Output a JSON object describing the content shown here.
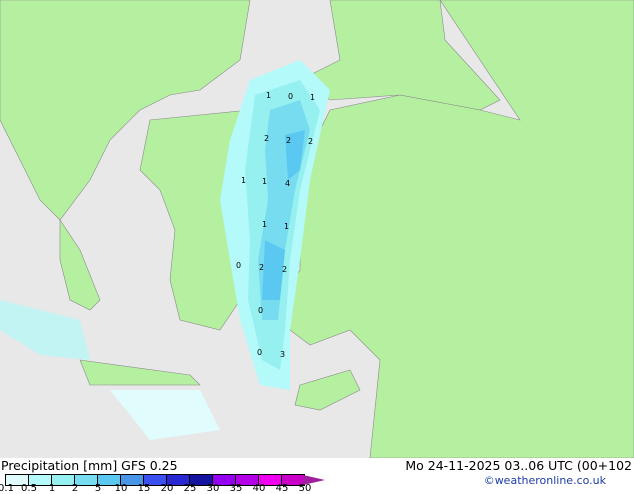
{
  "map": {
    "land_color": "#b4f0a0",
    "sea_color": "#e8e8e8",
    "precip_labels": [
      "1",
      "0",
      "1",
      "2",
      "2",
      "2",
      "1",
      "1",
      "4",
      "1",
      "1",
      "0",
      "2",
      "2",
      "0",
      "0",
      "3"
    ]
  },
  "footer": {
    "title": "Precipitation [mm]  GFS 0.25",
    "valid_time": "Mo 24-11-2025 03..06 UTC (00+102",
    "credit": "©weatheronline.co.uk"
  },
  "legend": {
    "ticks": [
      "0.1",
      "0.5",
      "1",
      "2",
      "5",
      "10",
      "15",
      "20",
      "25",
      "30",
      "35",
      "40",
      "45",
      "50"
    ],
    "colors": [
      "#e0fcfc",
      "#b4fafa",
      "#96f0f0",
      "#78dcf0",
      "#5ac8f0",
      "#4a96e6",
      "#3c50f0",
      "#2828d2",
      "#1414a0",
      "#9600f0",
      "#b400e6",
      "#f000f0",
      "#c800c8"
    ]
  }
}
